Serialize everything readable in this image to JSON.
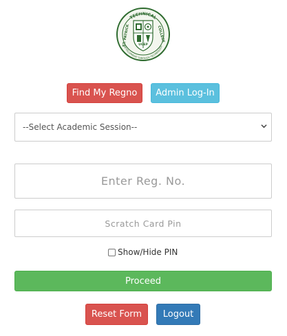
{
  "logo": {
    "top_text": "TECHNICAL",
    "right_text": "COLLEGE",
    "left_text": "ST. PATRICK",
    "bottom_text": "UGEP",
    "motto": "DEVELOPMENT THROUGH TECHNOLOGY"
  },
  "top_buttons": {
    "find_regno": "Find My Regno",
    "admin_login": "Admin Log-In"
  },
  "session_select": {
    "selected": "--Select Academic Session--"
  },
  "regno_input": {
    "placeholder": "Enter Reg. No."
  },
  "pin_input": {
    "placeholder": "Scratch Card Pin"
  },
  "show_pin": {
    "label": "Show/Hide PIN",
    "checked": false
  },
  "proceed_button": "Proceed",
  "bottom_buttons": {
    "reset": "Reset Form",
    "logout": "Logout"
  },
  "colors": {
    "danger": "#d9534f",
    "info": "#5bc0de",
    "success": "#5cb85c",
    "primary": "#337ab7",
    "logo_green": "#2e6b2f"
  }
}
